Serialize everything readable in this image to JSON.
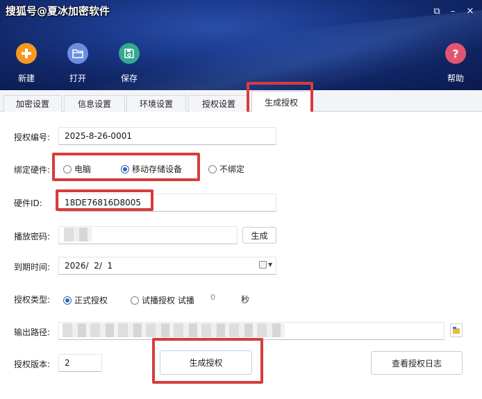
{
  "watermark": "搜狐号@夏冰加密软件",
  "window_controls": {
    "restore": "⧉",
    "minimize": "–",
    "close": "✕"
  },
  "toolbar": {
    "new_label": "新建",
    "open_label": "打开",
    "save_label": "保存",
    "help_label": "帮助"
  },
  "tabs": [
    {
      "label": "加密设置"
    },
    {
      "label": "信息设置"
    },
    {
      "label": "环境设置"
    },
    {
      "label": "授权设置"
    },
    {
      "label": "生成授权",
      "active": true
    }
  ],
  "form": {
    "auth_number_label": "授权编号:",
    "auth_number_value": "2025-8-26-0001",
    "bind_hardware_label": "绑定硬件:",
    "bind_options": [
      {
        "label": "电脑",
        "selected": false
      },
      {
        "label": "移动存储设备",
        "selected": true
      },
      {
        "label": "不绑定",
        "selected": false
      }
    ],
    "hardware_id_label": "硬件ID:",
    "hardware_id_value": "18DE76816D8005",
    "play_password_label": "播放密码:",
    "generate_label": "生成",
    "expire_label": "到期时间:",
    "expire_value": "2026/  2/  1",
    "auth_type_label": "授权类型:",
    "auth_type_options": [
      {
        "label": "正式授权",
        "selected": true
      },
      {
        "label": "试播授权 试播",
        "selected": false
      }
    ],
    "trial_seconds": "0",
    "seconds_unit": "秒",
    "output_path_label": "输出路径:",
    "auth_version_label": "授权版本:",
    "auth_version_value": "2",
    "generate_auth_button": "生成授权",
    "view_log_button": "查看授权日志"
  },
  "colors": {
    "highlight": "#d83c3c",
    "accent": "#2469c7"
  }
}
